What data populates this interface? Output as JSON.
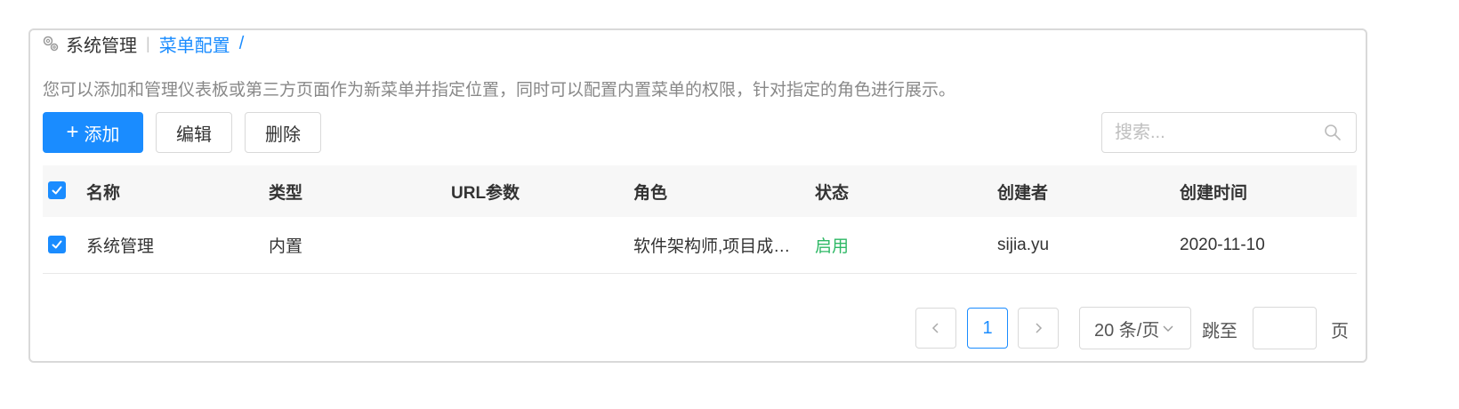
{
  "breadcrumb": {
    "root": "系统管理",
    "separator": "|",
    "current": "菜单配置",
    "slash": "/"
  },
  "description": "您可以添加和管理仪表板或第三方页面作为新菜单并指定位置，同时可以配置内置菜单的权限，针对指定的角色进行展示。",
  "toolbar": {
    "add_icon": "+",
    "add_label": "添加",
    "edit_label": "编辑",
    "delete_label": "删除",
    "search_placeholder": "搜索..."
  },
  "table": {
    "header_checked": true,
    "columns": [
      "名称",
      "类型",
      "URL参数",
      "角色",
      "状态",
      "创建者",
      "创建时间"
    ],
    "rows": [
      {
        "checked": true,
        "name": "系统管理",
        "type": "内置",
        "url_params": "",
        "roles": "软件架构师,项目成…",
        "status": "启用",
        "creator": "sijia.yu",
        "created_at": "2020-11-10"
      }
    ]
  },
  "pagination": {
    "current_page": "1",
    "page_size": "20 条/页",
    "jump_label": "跳至",
    "jump_value": "",
    "page_suffix": "页"
  },
  "colors": {
    "primary": "#1a8cff",
    "status_enabled": "#2eb865"
  },
  "icons": [
    "gear-icon",
    "plus-icon",
    "search-icon",
    "checkbox-checked-icon",
    "chevron-left-icon",
    "chevron-right-icon",
    "chevron-down-icon"
  ]
}
